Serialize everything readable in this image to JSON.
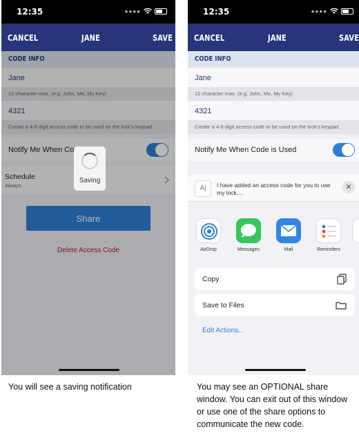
{
  "status_time": "12:35",
  "left_phone": {
    "nav": {
      "cancel": "CANCEL",
      "title": "JANE",
      "save": "SAVE"
    },
    "code_info_header": "CODE INFO",
    "name_value": "Jane",
    "name_hint": "12 character max. (e.g. John, Me, My Key)",
    "code_value": "4321",
    "code_hint": "Create a 4-8 digit access code to be used on the lock's keypad.",
    "notify_label": "Notify Me When Code",
    "notify_on": true,
    "schedule_label": "Schedule",
    "schedule_value": "Always",
    "saving_label": "Saving",
    "share_button": "Share",
    "delete_link": "Delete Access Code"
  },
  "right_phone": {
    "nav": {
      "cancel": "CANCEL",
      "title": "JANE",
      "save": "SAVE"
    },
    "code_info_header": "CODE INFO",
    "name_value": "Jane",
    "name_hint": "12 character max. (e.g. John, Me, My Key)",
    "code_value": "4321",
    "code_hint": "Create a 4-8 digit access code to be used on the lock's keypad.",
    "notify_label": "Notify Me When Code is Used",
    "notify_on": true,
    "share_sheet": {
      "message": "I have added an access code for you to use my lock....",
      "apps": [
        {
          "label": "AirDrop",
          "icon": "airdrop-icon"
        },
        {
          "label": "Messages",
          "icon": "messages-icon"
        },
        {
          "label": "Mail",
          "icon": "mail-icon"
        },
        {
          "label": "Reminders",
          "icon": "reminders-icon"
        }
      ],
      "actions": [
        {
          "label": "Copy",
          "icon": "copy-icon"
        },
        {
          "label": "Save to Files",
          "icon": "folder-icon"
        }
      ],
      "edit_actions": "Edit Actions..."
    }
  },
  "captions": {
    "left": "You will see a saving notification",
    "right": "You may see an OPTIONAL share window. You can exit out of this window or use one of the share options to communicate the new code."
  },
  "colors": {
    "nav": "#27367a",
    "accent": "#2f7fd6",
    "delete": "#b02020"
  }
}
